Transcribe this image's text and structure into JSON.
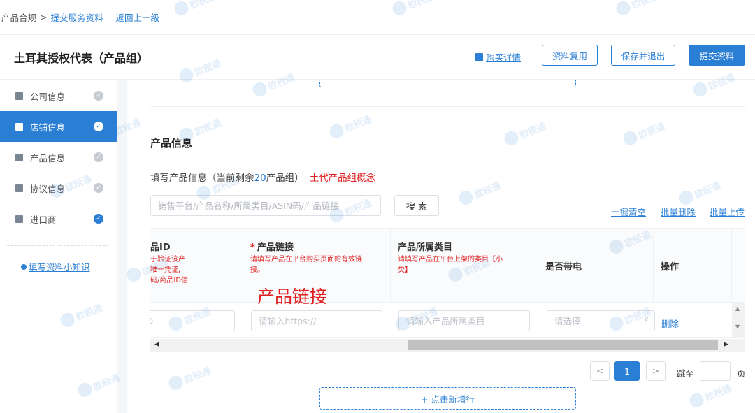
{
  "breadcrumb": {
    "home": "产品合规",
    "separator": ">",
    "current": "提交服务资料",
    "back": "返回上一级"
  },
  "header": {
    "title": "土耳其授权代表（产品组）",
    "buy_details": "购买详情",
    "reuse_button": "资料复用",
    "save_exit_button": "保存并退出",
    "submit_button": "提交资料"
  },
  "sidebar": {
    "items": [
      {
        "label": "公司信息",
        "icon": "building-icon",
        "status": "done"
      },
      {
        "label": "店铺信息",
        "icon": "shop-icon",
        "status": "active"
      },
      {
        "label": "产品信息",
        "icon": "box-icon",
        "status": "done"
      },
      {
        "label": "协议信息",
        "icon": "document-icon",
        "status": "done"
      },
      {
        "label": "进口商",
        "icon": "importer-icon",
        "status": "checked"
      }
    ],
    "tip_link": "填写资料小知识"
  },
  "main": {
    "section_title": "产品信息",
    "desc_prefix": "填写产品信息（当前剩余",
    "desc_count": "20",
    "desc_suffix": "产品组）",
    "concept_link": "土代产品组概念",
    "search_placeholder": "销售平台/产品名称/所属类目/ASIN码/产品链接",
    "search_button": "搜 索",
    "clear_all": "一键清空",
    "batch_delete": "批量删除",
    "batch_upload": "批量上传"
  },
  "table": {
    "columns": [
      {
        "title": "品ID",
        "required": false,
        "hint": "于验证该产\n唯一凭证,\n码/商品ID信"
      },
      {
        "title": "产品链接",
        "required": true,
        "hint": "请填写产品在平台购买页面的有效链\n接。"
      },
      {
        "title": "产品所属类目",
        "required": false,
        "hint": "请填写产品在平台上架的类目【小\n类】"
      },
      {
        "title": "是否带电",
        "required": false,
        "hint": ""
      },
      {
        "title": "操作",
        "required": false,
        "hint": ""
      }
    ],
    "overlay_label": "产品链接",
    "row": {
      "id_placeholder": "ID",
      "link_placeholder": "请输入https://",
      "category_placeholder": "请输入产品所属类目",
      "electric_placeholder": "请选择",
      "delete_label": "删除"
    }
  },
  "pagination": {
    "current_page": "1",
    "jump_label": "跳至",
    "page_unit": "页"
  },
  "add_row_button": "+ 点击新增行",
  "watermark_text": "欧税通",
  "colors": {
    "primary": "#2a7fd4",
    "danger": "#e02020",
    "border": "#dcdfe6"
  }
}
